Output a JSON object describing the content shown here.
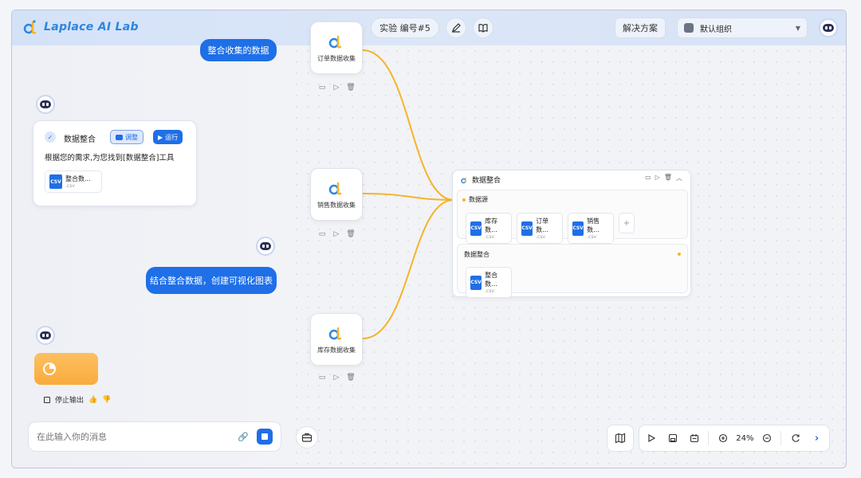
{
  "app": {
    "logo_text": "Laplace AI Lab"
  },
  "topbar": {
    "experiment_label": "实验 编号#5",
    "solutions_label": "解决方案",
    "org_label": "默认组织"
  },
  "chat": {
    "user_msg_1": "整合收集的数据",
    "assistant_card": {
      "title": "数据整合",
      "adjust_label": "调整",
      "run_label": "运行",
      "body": "根据您的需求,为您找到[数据整合]工具",
      "file_name": "整合数...",
      "file_ext": ".csv"
    },
    "user_msg_2": "结合整合数据，创建可视化图表",
    "stop_label": "停止输出",
    "input_placeholder": "在此输入你的消息"
  },
  "nodes": [
    {
      "label": "订单数据收集"
    },
    {
      "label": "销售数据收集"
    },
    {
      "label": "库存数据收集"
    }
  ],
  "integration_card": {
    "title": "数据整合",
    "source_section": "数据源",
    "sources": [
      {
        "name": "库存数...",
        "ext": ".csv"
      },
      {
        "name": "订单数...",
        "ext": ".csv"
      },
      {
        "name": "销售数...",
        "ext": ".csv"
      }
    ],
    "output_section": "数据整合",
    "output": {
      "name": "整合数...",
      "ext": ".csv"
    }
  },
  "toolbar": {
    "zoom": "24%"
  },
  "colors": {
    "accent": "#1e6fe8",
    "edge": "#f5b428",
    "orange": "#fbb34a"
  }
}
